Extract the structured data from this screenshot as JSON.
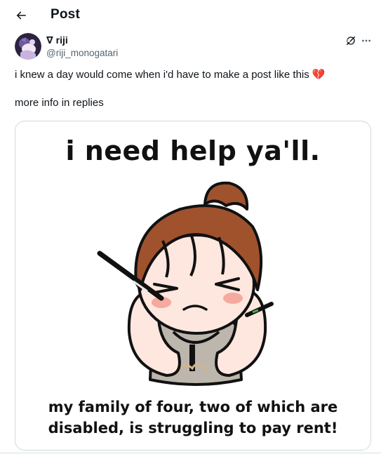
{
  "header": {
    "title": "Post",
    "back_icon": "arrow-left-icon"
  },
  "author": {
    "name": "∇ riji",
    "handle": "@riji_monogatari"
  },
  "actions": {
    "grok_icon": "grok-icon",
    "more_icon": "more-horizontal-icon"
  },
  "post": {
    "text": "i knew a day would come when i'd have to make a post like this 💔\n\nmore info in replies"
  },
  "media": {
    "title": "i need help ya'll.",
    "caption": "my family of four, two of which are\ndisabled, is struggling to pay rent!"
  },
  "colors": {
    "text": "#0f1419",
    "secondary": "#536471",
    "border": "#cfd9de",
    "hair": "#a0522d"
  }
}
